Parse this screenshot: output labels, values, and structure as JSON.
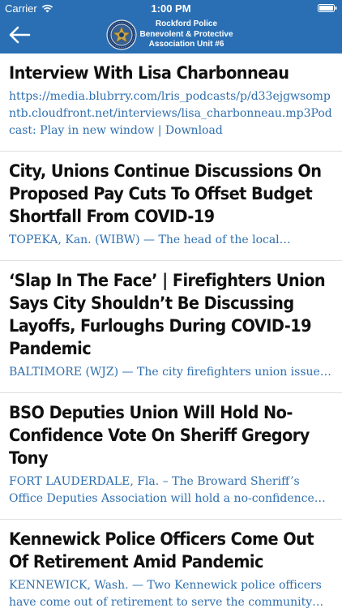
{
  "status_bar": {
    "carrier": "Carrier",
    "time": "1:00 PM"
  },
  "nav": {
    "title": "Rockford Police Benevolent & Protective Association Unit #6",
    "colors": {
      "bar": "#2a6fb4",
      "text": "#ffffff"
    }
  },
  "articles": [
    {
      "title": "Interview With Lisa Charbonneau",
      "snippet": "https://media.blubrry.com/lris_podcasts/p/d33ejgwsompntb.cloudfront.net/interviews/lisa_charbonneau.mp3Podcast: Play in new window | Download"
    },
    {
      "title": "City, Unions Continue Discussions On Proposed Pay Cuts To Offset Budget Shortfall From COVID-19",
      "snippet": "TOPEKA, Kan. (WIBW) — The head of the local Fraternal Order of Police"
    },
    {
      "title": "‘Slap In The Face’ | Firefighters Union Says City Shouldn’t Be Discussing Layoffs, Furloughs During COVID-19 Pandemic",
      "snippet": "BALTIMORE (WJZ) — The city firefighters union issued a statement"
    },
    {
      "title": "BSO Deputies Union Will Hold No-Confidence Vote On Sheriff Gregory Tony",
      "snippet": "FORT LAUDERDALE, Fla. – The Broward Sheriff’s Office Deputies Association will hold a no-confidence vote on Sheriff Gregory Tony"
    },
    {
      "title": "Kennewick Police Officers Come Out Of Retirement Amid Pandemic",
      "snippet": "KENNEWICK, Wash. — Two Kennewick police officers have come out of retirement to serve the community during the pandemic"
    }
  ]
}
